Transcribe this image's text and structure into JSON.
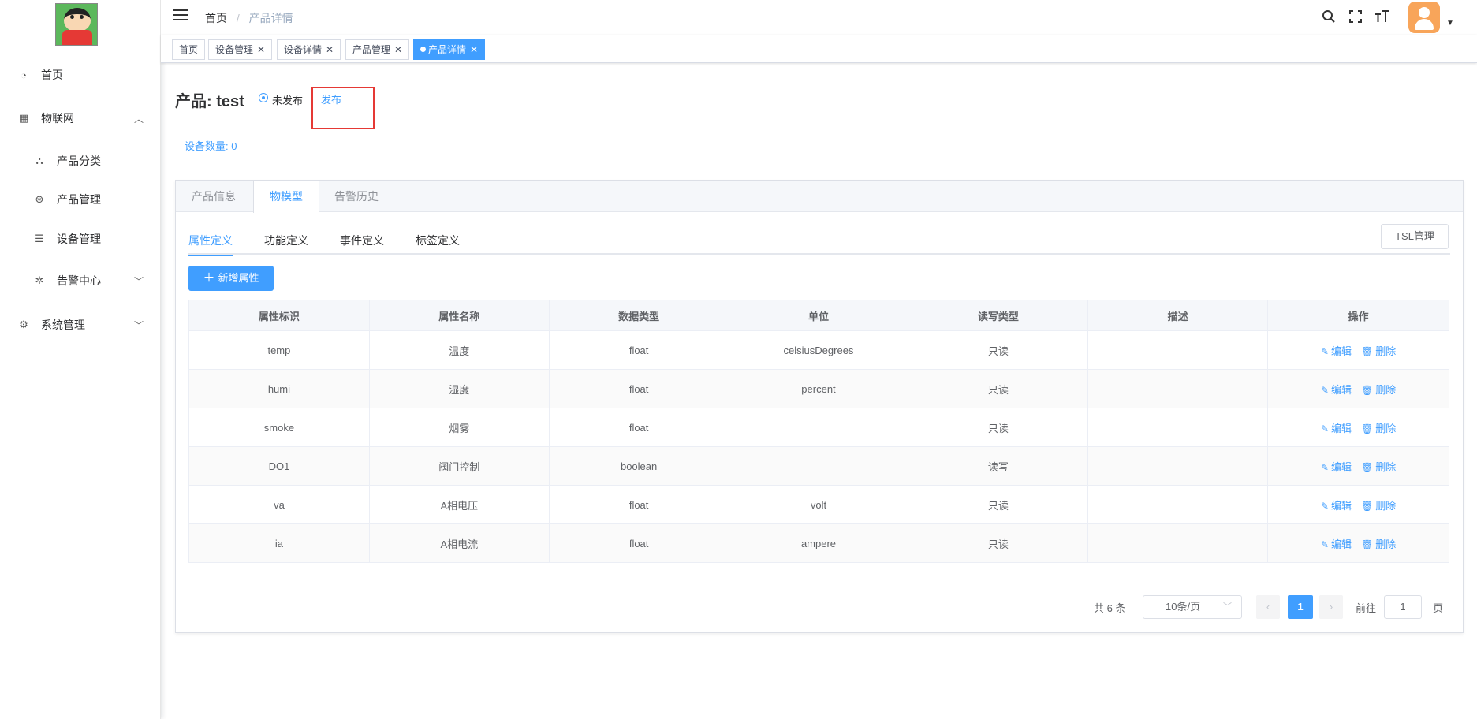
{
  "sidebar": {
    "items": [
      {
        "label": "首页",
        "icon": "dashboard-icon"
      },
      {
        "label": "物联网",
        "icon": "grid-icon",
        "expanded": true
      },
      {
        "label": "产品分类",
        "icon": "hierarchy-icon"
      },
      {
        "label": "产品管理",
        "icon": "ring-icon"
      },
      {
        "label": "设备管理",
        "icon": "sliders-icon"
      },
      {
        "label": "告警中心",
        "icon": "bug-icon"
      },
      {
        "label": "系统管理",
        "icon": "gear-icon"
      }
    ]
  },
  "header": {
    "breadcrumb_home": "首页",
    "breadcrumb_sep": "/",
    "breadcrumb_current": "产品详情"
  },
  "tags": [
    {
      "label": "首页"
    },
    {
      "label": "设备管理"
    },
    {
      "label": "设备详情"
    },
    {
      "label": "产品管理"
    },
    {
      "label": "产品详情",
      "active": true
    }
  ],
  "product": {
    "title": "产品: test",
    "status": "未发布",
    "publish_label": "发布",
    "device_count": "设备数量: 0"
  },
  "card_tabs": [
    "产品信息",
    "物模型",
    "告警历史"
  ],
  "sub_tabs": [
    "属性定义",
    "功能定义",
    "事件定义",
    "标签定义"
  ],
  "tsl_button": "TSL管理",
  "add_button": "新增属性",
  "table": {
    "columns": [
      "属性标识",
      "属性名称",
      "数据类型",
      "单位",
      "读写类型",
      "描述",
      "操作"
    ],
    "rows": [
      [
        "temp",
        "温度",
        "float",
        "celsiusDegrees",
        "只读",
        ""
      ],
      [
        "humi",
        "湿度",
        "float",
        "percent",
        "只读",
        ""
      ],
      [
        "smoke",
        "烟雾",
        "float",
        "",
        "只读",
        ""
      ],
      [
        "DO1",
        "阀门控制",
        "boolean",
        "",
        "读写",
        ""
      ],
      [
        "va",
        "A相电压",
        "float",
        "volt",
        "只读",
        ""
      ],
      [
        "ia",
        "A相电流",
        "float",
        "ampere",
        "只读",
        ""
      ]
    ],
    "edit_label": "编辑",
    "delete_label": "删除"
  },
  "pagination": {
    "total": "共 6 条",
    "page_size": "10条/页",
    "current_page": "1",
    "goto_label": "前往",
    "goto_value": "1",
    "page_suffix": "页"
  },
  "colors": {
    "primary": "#409eff",
    "highlight": "#e53935"
  }
}
